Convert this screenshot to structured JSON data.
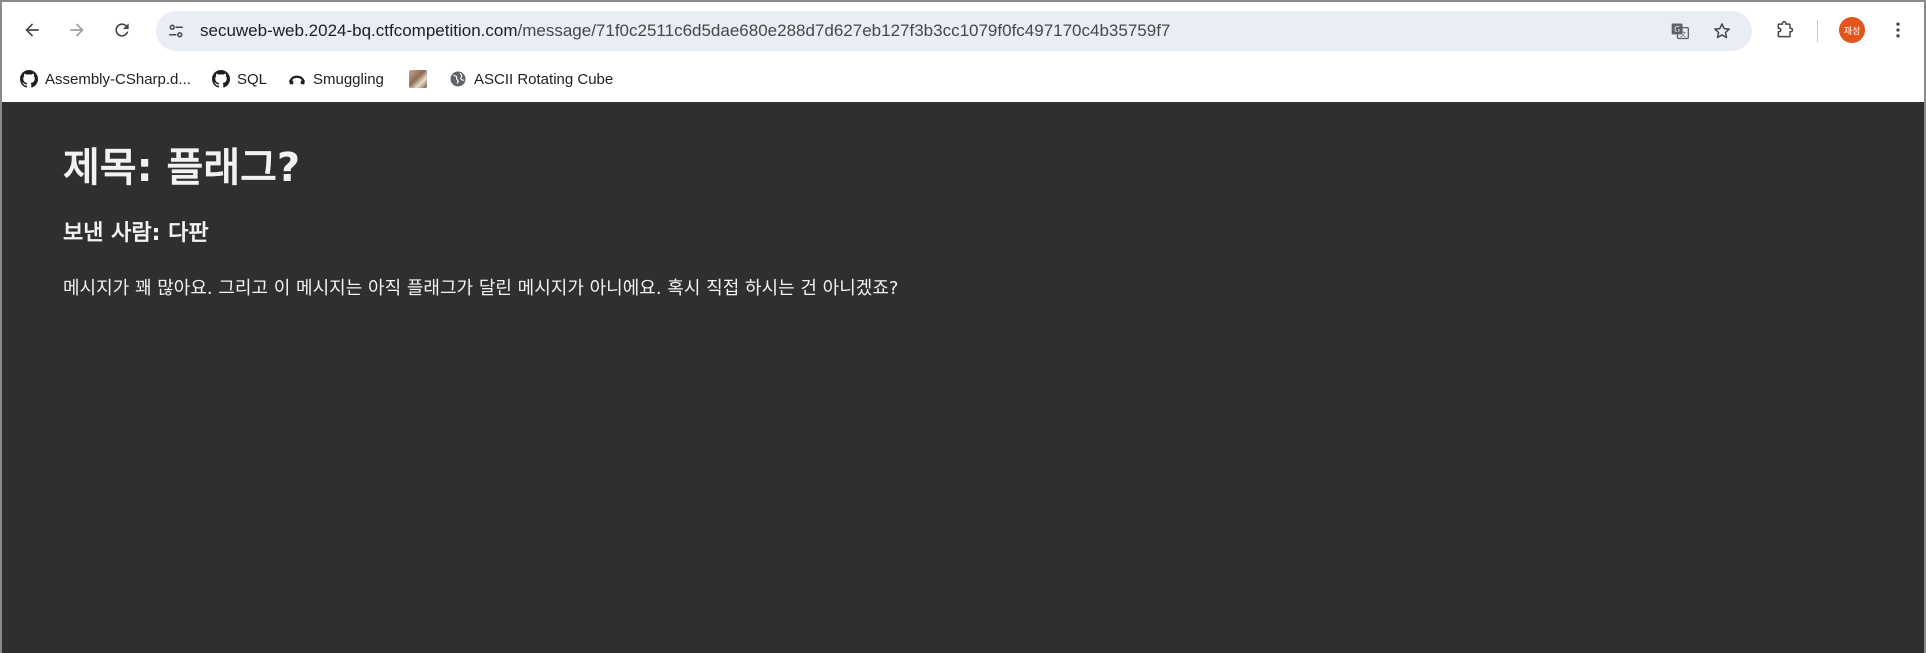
{
  "browser": {
    "url_host": "secuweb-web.2024-bq.ctfcompetition.com",
    "url_path": "/message/71f0c2511c6d5dae680e288d7d627eb127f3b3cc1079f0fc497170c4b35759f7",
    "profile_initials": "재성",
    "icons": {
      "back": "back-arrow-icon",
      "forward": "forward-arrow-icon",
      "reload": "reload-icon",
      "site_info": "tune-icon",
      "translate": "translate-icon",
      "bookmark_star": "star-icon",
      "extensions": "puzzle-icon",
      "menu": "kebab-menu-icon"
    },
    "accent_avatar_color": "#e4551c"
  },
  "bookmarks": [
    {
      "label": "Assembly-CSharp.d...",
      "icon": "github-icon"
    },
    {
      "label": "SQL",
      "icon": "github-icon"
    },
    {
      "label": "Smuggling",
      "icon": "smuggling-icon"
    },
    {
      "label": "",
      "icon": "thumbnail-image"
    },
    {
      "label": "ASCII Rotating Cube",
      "icon": "globe-icon"
    }
  ],
  "message": {
    "title": "제목: 플래그?",
    "sender": "보낸 사람: 다판",
    "body": "메시지가 꽤 많아요. 그리고 이 메시지는 아직 플래그가 달린 메시지가 아니에요. 혹시 직접 하시는 건 아니겠죠?"
  },
  "colors": {
    "page_background": "#2f2f2f",
    "omnibox_background": "#e9eef6"
  }
}
